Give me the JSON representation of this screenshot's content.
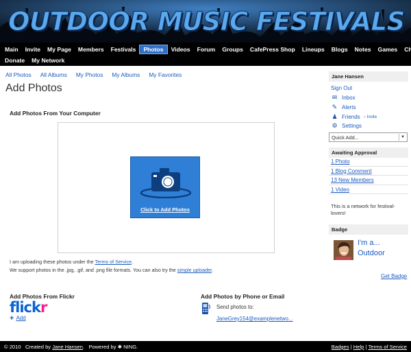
{
  "header": {
    "title": "OUTDOOR MUSIC FESTIVALS"
  },
  "nav": {
    "row1": [
      "Main",
      "Invite",
      "My Page",
      "Members",
      "Festivals",
      "Photos",
      "Videos",
      "Forum",
      "Groups",
      "CafePress Shop",
      "Lineups",
      "Blogs",
      "Notes",
      "Games",
      "Chat"
    ],
    "row2": [
      "Donate",
      "My Network"
    ],
    "active": "Photos"
  },
  "subnav": [
    "All Photos",
    "All Albums",
    "My Photos",
    "My Albums",
    "My Favorites"
  ],
  "page_title": "Add Photos",
  "computer": {
    "heading": "Add Photos From Your Computer",
    "button_label": "Click to Add Photos"
  },
  "notes": {
    "line1_prefix": "I am uploading these photos under the ",
    "line1_link": "Terms of Service",
    "line1_suffix": ".",
    "line2_prefix": "We support photos in the .jpg, .gif, and .png file formats. You can also try the ",
    "line2_link": "simple uploader",
    "line2_suffix": "."
  },
  "flickr": {
    "heading": "Add Photos From Flickr",
    "logo_a": "flick",
    "logo_b": "r",
    "add_label": "Add"
  },
  "phone": {
    "heading": "Add Photos by Phone or Email",
    "send_label": "Send photos to:",
    "email": "JaneGrey154@examplenetwo..."
  },
  "sidebar": {
    "user_name": "Jane Hansen",
    "sign_out": "Sign Out",
    "inbox": "Inbox",
    "alerts": "Alerts",
    "friends": "Friends",
    "friends_invite": "– Invite",
    "settings": "Settings",
    "quick_add": "Quick Add...",
    "awaiting_heading": "Awaiting Approval",
    "awaiting": [
      "1 Photo",
      "1 Blog Comment",
      "13 New Members",
      "1 Video"
    ],
    "network_desc_1": "This is a network for festival-",
    "network_desc_2": "lovers!",
    "badge_heading": "Badge",
    "badge_line1": "I'm a...",
    "badge_line2": "Outdoor",
    "get_badge": "Get Badge"
  },
  "footer": {
    "copyright": "© 2010",
    "created_by": "Created by",
    "creator": "Jane Hansen",
    "powered_by": "Powered by",
    "ning": "NING.",
    "links": [
      "Badges",
      "Help",
      "Terms of Service"
    ]
  },
  "colors": {
    "accent": "#2f7fd6",
    "link": "#1a5bbf",
    "nav_bg": "#000000",
    "flickr_blue": "#0a63d3",
    "flickr_pink": "#ff1a86"
  }
}
